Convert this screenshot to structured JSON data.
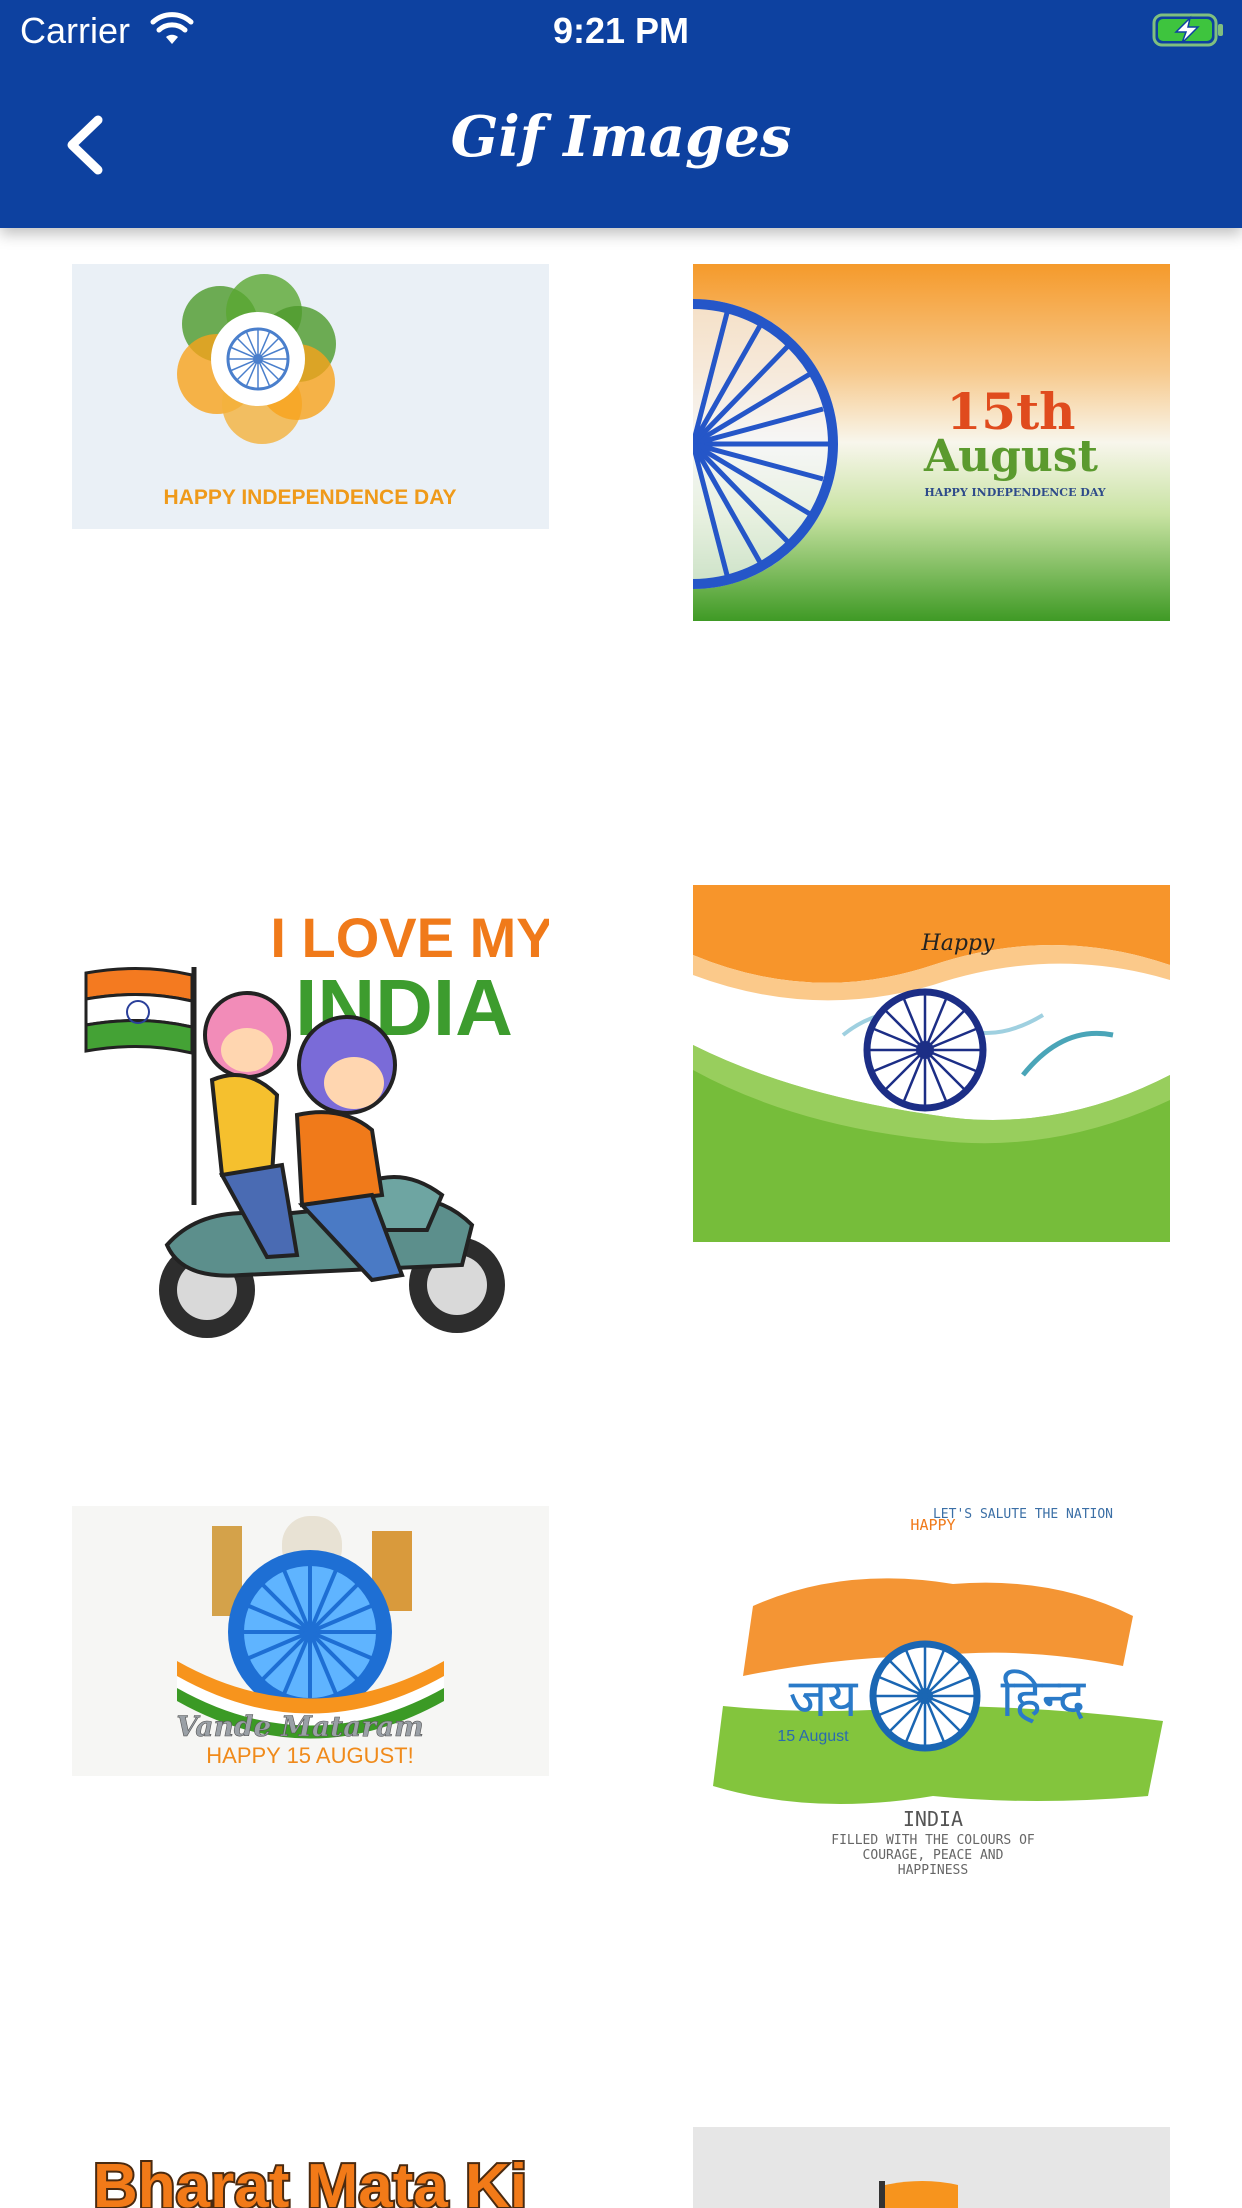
{
  "status_bar": {
    "carrier": "Carrier",
    "time": "9:21 PM",
    "wifi_icon": "wifi-icon",
    "battery_icon": "battery-charging-icon"
  },
  "nav": {
    "title": "Gif Images",
    "back_icon": "chevron-left-icon"
  },
  "colors": {
    "header": "#0d41a0",
    "saffron": "#f7941d",
    "green": "#3b9a25",
    "chakra_blue": "#1a3f9e",
    "background": "#ffffff"
  },
  "tiles": [
    {
      "caption": "HAPPY INDEPENDENCE DAY"
    },
    {
      "line1": "15th",
      "line2": "August",
      "line3": "HAPPY INDEPENDENCE DAY"
    },
    {
      "line1": "I LOVE MY",
      "line2": "INDIA"
    },
    {
      "text": "Happy"
    },
    {
      "line1": "Vande Mataram",
      "line2": "HAPPY 15 AUGUST!"
    },
    {
      "top": "LET'S SALUTE THE NATION",
      "happy": "HAPPY",
      "left": "जय",
      "right": "हिन्द",
      "date": "15 August",
      "country": "INDIA",
      "body1": "FILLED WITH THE COLOURS OF",
      "body2": "COURAGE, PEACE AND",
      "body3": "HAPPINESS"
    },
    {
      "text": "Bharat Mata Ki"
    },
    {
      "text": ""
    }
  ]
}
